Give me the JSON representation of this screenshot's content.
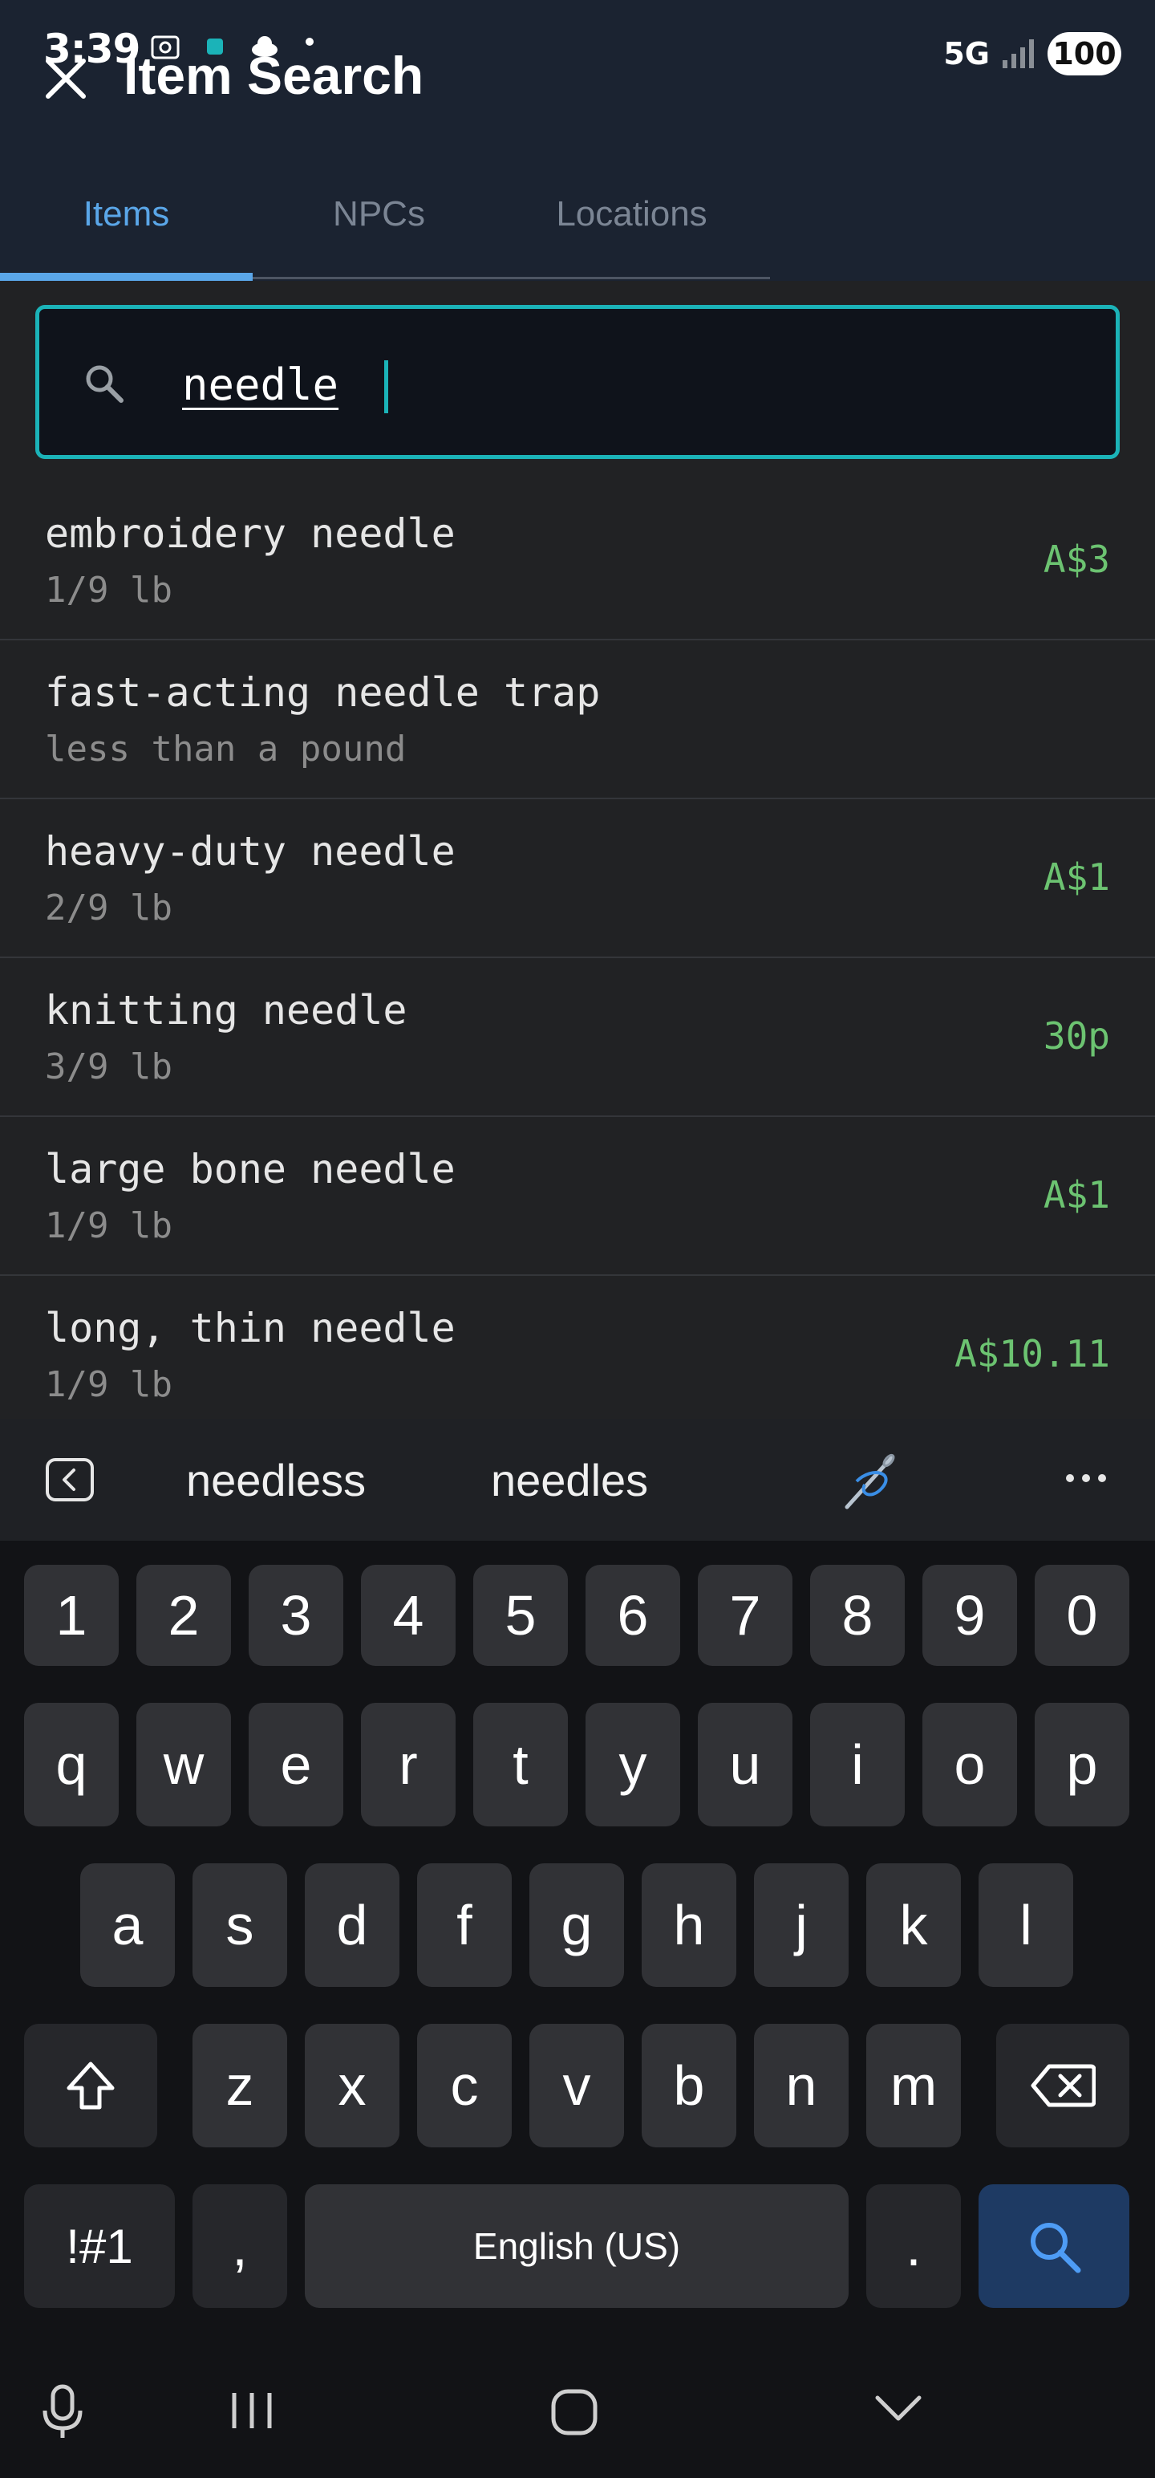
{
  "status_bar": {
    "time": "3:39",
    "network": "5G",
    "battery": "100"
  },
  "header": {
    "title": "Item Search",
    "close_icon": "close-icon"
  },
  "tabs": [
    {
      "label": "Items",
      "active": true
    },
    {
      "label": "NPCs",
      "active": false
    },
    {
      "label": "Locations",
      "active": false
    }
  ],
  "search": {
    "value": "needle",
    "icon": "search-icon"
  },
  "results": [
    {
      "name": "embroidery needle",
      "weight": "1/9 lb",
      "price": "A$3"
    },
    {
      "name": "fast-acting needle trap",
      "weight": "less than a pound",
      "price": ""
    },
    {
      "name": "heavy-duty needle",
      "weight": "2/9 lb",
      "price": "A$1"
    },
    {
      "name": "knitting needle",
      "weight": "3/9 lb",
      "price": "30p"
    },
    {
      "name": "large bone needle",
      "weight": "1/9 lb",
      "price": "A$1"
    },
    {
      "name": "long, thin needle",
      "weight": "1/9 lb",
      "price": "A$10.11"
    }
  ],
  "keyboard": {
    "suggestions": [
      "needless",
      "needles"
    ],
    "row_numbers": [
      "1",
      "2",
      "3",
      "4",
      "5",
      "6",
      "7",
      "8",
      "9",
      "0"
    ],
    "row_1": [
      "q",
      "w",
      "e",
      "r",
      "t",
      "y",
      "u",
      "i",
      "o",
      "p"
    ],
    "row_2": [
      "a",
      "s",
      "d",
      "f",
      "g",
      "h",
      "j",
      "k",
      "l"
    ],
    "row_3": [
      "z",
      "x",
      "c",
      "v",
      "b",
      "n",
      "m"
    ],
    "symbols_label": "!#1",
    "comma": ",",
    "space_label": "English (US)",
    "period": "."
  },
  "colors": {
    "accent_tab": "#5aa6e8",
    "search_border": "#1bb3b8",
    "price": "#6cc371"
  }
}
